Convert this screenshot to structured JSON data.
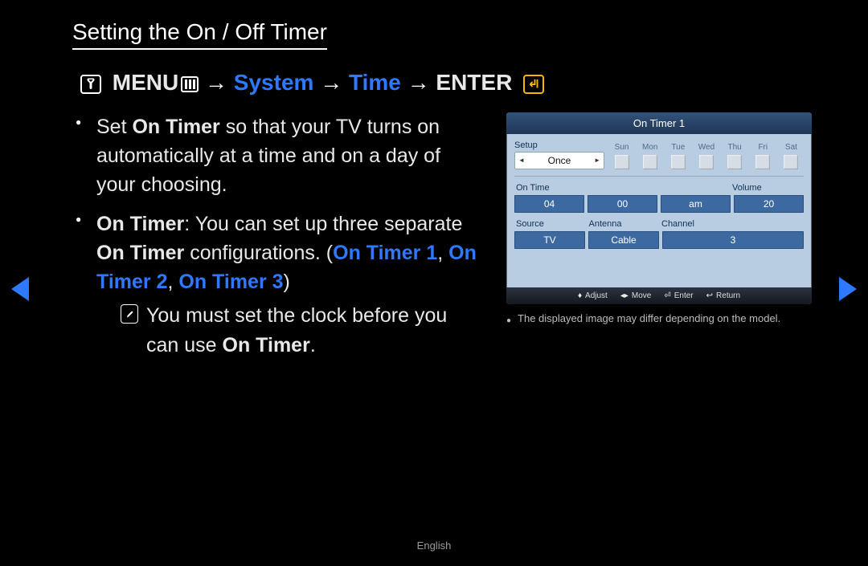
{
  "heading": "Setting the On / Off Timer",
  "breadcrumb": {
    "menu": "MENU",
    "arrow": "→",
    "system": "System",
    "time": "Time",
    "enter": "ENTER"
  },
  "bullets": {
    "b1_pre": "Set ",
    "b1_bold": "On Timer",
    "b1_post": " so that your TV turns on automatically at a time and on a day of your choosing.",
    "b2_bold1": "On Timer",
    "b2_mid1": ": You can set up three separate ",
    "b2_bold2": "On Timer",
    "b2_mid2": " configurations. (",
    "b2_hl1": "On Timer 1",
    "b2_c1": ", ",
    "b2_hl2": "On Timer 2",
    "b2_c2": ", ",
    "b2_hl3": "On Timer 3",
    "b2_close": ")",
    "note_pre": "You must set the clock before you can use ",
    "note_bold": "On Timer",
    "note_post": "."
  },
  "osd": {
    "title": "On Timer 1",
    "setup_label": "Setup",
    "once": "Once",
    "days": [
      "Sun",
      "Mon",
      "Tue",
      "Wed",
      "Thu",
      "Fri",
      "Sat"
    ],
    "ontime_label": "On Time",
    "volume_label": "Volume",
    "hour": "04",
    "minute": "00",
    "ampm": "am",
    "volume": "20",
    "source_label": "Source",
    "antenna_label": "Antenna",
    "channel_label": "Channel",
    "source": "TV",
    "antenna": "Cable",
    "channel": "3",
    "foot_adjust": "Adjust",
    "foot_move": "Move",
    "foot_enter": "Enter",
    "foot_return": "Return"
  },
  "footnote": "The displayed image may differ depending on the model.",
  "language": "English"
}
